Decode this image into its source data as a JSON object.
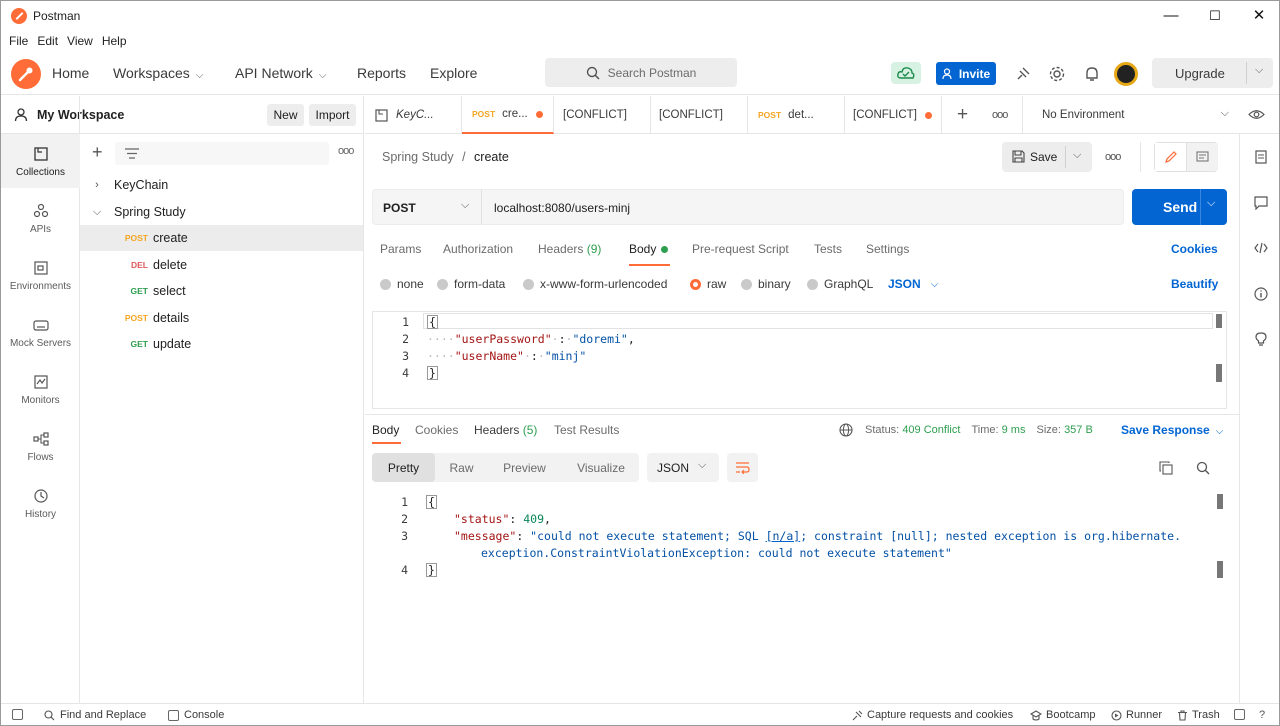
{
  "window": {
    "title": "Postman",
    "minimize": "—",
    "maximize": "☐",
    "close": "✕"
  },
  "menu": [
    "File",
    "Edit",
    "View",
    "Help"
  ],
  "nav": {
    "home": "Home",
    "workspaces": "Workspaces",
    "api_network": "API Network",
    "reports": "Reports",
    "explore": "Explore"
  },
  "search": {
    "placeholder": "Search Postman"
  },
  "header": {
    "invite": "Invite",
    "upgrade": "Upgrade"
  },
  "workspace": {
    "name": "My Workspace",
    "new_label": "New",
    "import_label": "Import"
  },
  "rail": [
    "Collections",
    "APIs",
    "Environments",
    "Mock Servers",
    "Monitors",
    "Flows",
    "History"
  ],
  "tree": {
    "collections": [
      {
        "name": "KeyChain",
        "expanded": false
      },
      {
        "name": "Spring Study",
        "expanded": true
      }
    ],
    "requests": [
      {
        "method": "POST",
        "name": "create",
        "color": "#f5a623",
        "selected": true
      },
      {
        "method": "DEL",
        "name": "delete",
        "color": "#e05a5a"
      },
      {
        "method": "GET",
        "name": "select",
        "color": "#2e9e4f"
      },
      {
        "method": "POST",
        "name": "details",
        "color": "#f5a623"
      },
      {
        "method": "GET",
        "name": "update",
        "color": "#2e9e4f"
      }
    ]
  },
  "tabs": [
    {
      "label": "KeyC...",
      "method": ""
    },
    {
      "label": "cre...",
      "method": "POST"
    },
    {
      "label": "[CONFLICT]",
      "method": ""
    },
    {
      "label": "[CONFLICT]",
      "method": ""
    },
    {
      "label": "det...",
      "method": "POST"
    },
    {
      "label": "[CONFLICT]",
      "method": ""
    }
  ],
  "environment": "No Environment",
  "request": {
    "breadcrumb_parent": "Spring Study",
    "breadcrumb_sep": "/",
    "breadcrumb_current": "create",
    "save_label": "Save",
    "method": "POST",
    "url": "localhost:8080/users-minj",
    "send_label": "Send",
    "tabs": [
      "Params",
      "Authorization",
      "Headers",
      "Body",
      "Pre-request Script",
      "Tests",
      "Settings"
    ],
    "headers_count": "(9)",
    "cookies_label": "Cookies",
    "body_types": [
      "none",
      "form-data",
      "x-www-form-urlencoded",
      "raw",
      "binary",
      "GraphQL"
    ],
    "raw_format": "JSON",
    "beautify_label": "Beautify",
    "body_lines": [
      "1",
      "2",
      "3",
      "4"
    ]
  },
  "response": {
    "tabs": [
      "Body",
      "Cookies",
      "Headers",
      "Test Results"
    ],
    "headers_count": "(5)",
    "status_label": "Status:",
    "status_value": "409 Conflict",
    "time_label": "Time:",
    "time_value": "9 ms",
    "size_label": "Size:",
    "size_value": "357 B",
    "save_response": "Save Response",
    "views": [
      "Pretty",
      "Raw",
      "Preview",
      "Visualize"
    ],
    "format": "JSON",
    "body_lines": [
      "1",
      "2",
      "3",
      "4"
    ],
    "json": {
      "status": 409,
      "message_part1": "\"could not execute statement; SQL ",
      "message_part2": "[n/a]",
      "message_part3": "; constraint [null]; nested exception is org.hibernate.",
      "message_part4": "exception.ConstraintViolationException: could not execute statement\""
    },
    "status_color": "#2e9e4f"
  },
  "footer": {
    "find_replace": "Find and Replace",
    "console": "Console",
    "capture": "Capture requests and cookies",
    "bootcamp": "Bootcamp",
    "runner": "Runner",
    "trash": "Trash"
  }
}
